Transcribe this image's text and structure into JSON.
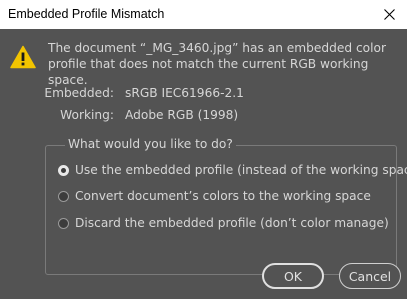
{
  "window": {
    "title": "Embedded Profile Mismatch",
    "close_icon": "close-icon"
  },
  "message": {
    "text": "The document “_MG_3460.jpg” has an embedded color profile that does not match the current RGB working space."
  },
  "profiles": {
    "embedded_label": "Embedded:",
    "embedded_value": "sRGB IEC61966-2.1",
    "working_label": "Working:",
    "working_value": "Adobe RGB (1998)"
  },
  "options": {
    "legend": "What would you like to do?",
    "items": [
      {
        "label": "Use the embedded profile (instead of the working space)",
        "checked": true
      },
      {
        "label": "Convert document’s colors to the working space",
        "checked": false
      },
      {
        "label": "Discard the embedded profile (don’t color manage)",
        "checked": false
      }
    ]
  },
  "buttons": {
    "ok": "OK",
    "cancel": "Cancel"
  },
  "colors": {
    "background": "#535353",
    "text": "#d6d6d6",
    "warning": "#f2c400"
  }
}
